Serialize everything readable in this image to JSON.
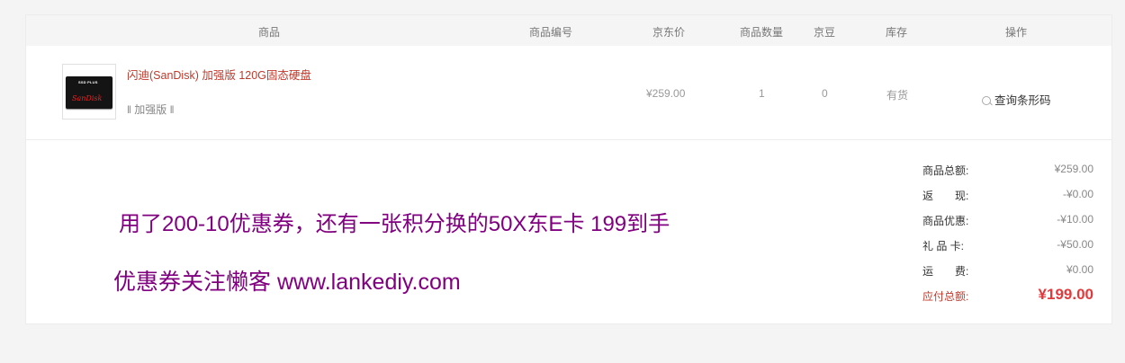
{
  "table_header": {
    "product": "商品",
    "sku": "商品编号",
    "jd_price": "京东价",
    "quantity": "商品数量",
    "jingdou": "京豆",
    "stock": "库存",
    "action": "操作"
  },
  "item": {
    "thumb_top_text": "SSD PLUS",
    "thumb_brand": "SanDisk",
    "title": "闪迪(SanDisk) 加强版 120G固态硬盘",
    "attribute": "‖ 加强版 ‖",
    "sku": "",
    "price": "¥259.00",
    "quantity": "1",
    "jingdou": "0",
    "stock": "有货",
    "action_label": "查询条形码"
  },
  "promo": {
    "line1": "用了200-10优惠券，还有一张积分换的50X东E卡 199到手",
    "line2": "优惠券关注懒客 www.lankediy.com"
  },
  "summary": {
    "goods_total_label": "商品总额:",
    "goods_total": "¥259.00",
    "cashback_label": "返　　现:",
    "cashback": "-¥0.00",
    "discount_label": "商品优惠:",
    "discount": "-¥10.00",
    "giftcard_label": "礼 品 卡:",
    "giftcard": "-¥50.00",
    "shipping_label": "运　　费:",
    "shipping": "¥0.00",
    "due_label": "应付总额:",
    "due": "¥199.00"
  },
  "colors": {
    "accent_red": "#e4393c",
    "link_red": "#c0392b",
    "promo_purple": "#800080"
  }
}
